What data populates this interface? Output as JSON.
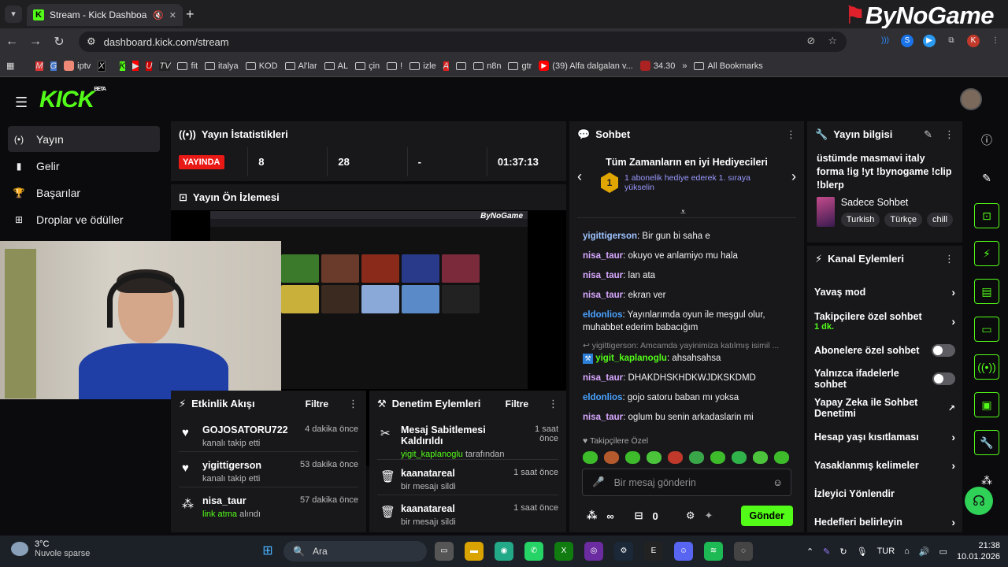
{
  "browser": {
    "tab_title": "Stream - Kick Dashboard",
    "url": "dashboard.kick.com/stream",
    "overlay_brand": "ByNoGame",
    "bookmarks": [
      "iptv",
      "fit",
      "italya",
      "KOD",
      "Al'lar",
      "AL",
      "çin",
      "!",
      "izle",
      "n8n",
      "gtr",
      "(39) Alfa dalgalan v...",
      "34.30"
    ],
    "all_bookmarks": "All Bookmarks",
    "profile_letter": "K"
  },
  "app": {
    "logo": "KICK",
    "logo_badge": "BETA",
    "nav": [
      {
        "label": "Yayın"
      },
      {
        "label": "Gelir"
      },
      {
        "label": "Başarılar"
      },
      {
        "label": "Droplar ve ödüller"
      }
    ]
  },
  "stats": {
    "title": "Yayın İstatistikleri",
    "live_label": "YAYINDA",
    "viewers": "8",
    "followers": "28",
    "dash": "-",
    "uptime": "01:37:13"
  },
  "preview": {
    "title": "Yayın Ön İzlemesi"
  },
  "activity": {
    "title": "Etkinlik Akışı",
    "filter": "Filtre",
    "items": [
      {
        "name": "GOJOSATORU722",
        "action": "kanalı takip etti",
        "time": "4 dakika önce"
      },
      {
        "name": "yigittigerson",
        "action": "kanalı takip etti",
        "time": "53 dakika önce"
      },
      {
        "name": "nisa_taur",
        "action_highlight": "link atma",
        "action": "alındı",
        "time": "57 dakika önce"
      }
    ]
  },
  "moderation": {
    "title": "Denetim Eylemleri",
    "filter": "Filtre",
    "items": [
      {
        "name": "Mesaj Sabitlemesi Kaldırıldı",
        "user": "yigit_kaplanoglu",
        "suffix": "tarafından",
        "time": "1 saat önce"
      },
      {
        "name": "kaanatareal",
        "action": "bir mesajı sildi",
        "time": "1 saat önce"
      },
      {
        "name": "kaanatareal",
        "action": "bir mesajı sildi",
        "time": "1 saat önce"
      }
    ]
  },
  "chat": {
    "title": "Sohbet",
    "gifters_title": "Tüm Zamanların en iyi Hediyecileri",
    "gift_rank": "1",
    "gift_text": "1 abonelik hediye ederek 1. sıraya yükselin",
    "messages": [
      {
        "user": "yigittigerson",
        "color": "#9ec3ff",
        "text": "Bir gun bi saha e"
      },
      {
        "user": "nisa_taur",
        "color": "#d8a8ff",
        "text": "okuyo ve anlamiyo mu hala"
      },
      {
        "user": "nisa_taur",
        "color": "#d8a8ff",
        "text": "lan ata"
      },
      {
        "user": "nisa_taur",
        "color": "#d8a8ff",
        "text": "ekran ver"
      },
      {
        "user": "eldonlios",
        "color": "#4aa3ff",
        "text": "Yayınlarımda oyun ile meşgul olur, muhabbet ederim babacığım"
      },
      {
        "reply": "yigittigerson: Amcamda yayinimiza katılmış isimil ...",
        "user": "yigit_kaplanoglu",
        "color": "#53fc18",
        "text": "ahsahsahsa"
      },
      {
        "user": "nisa_taur",
        "color": "#d8a8ff",
        "text": "DHAKDHSKHDKWJDKSKDMD"
      },
      {
        "user": "eldonlios",
        "color": "#4aa3ff",
        "text": "gojo satoru baban mı yoksa"
      },
      {
        "user": "nisa_taur",
        "color": "#d8a8ff",
        "text": "oglum bu senin arkadaslarin mi"
      }
    ],
    "follower_only": "Takipçilere Özel",
    "placeholder": "Bir mesaj gönderin",
    "points": "∞",
    "gift_count": "0",
    "send": "Gönder"
  },
  "stream_info": {
    "title": "Yayın bilgisi",
    "stream_title": "üstümde masmavi italy forma !ig !yt !bynogame !clip !blerp",
    "category": "Sadece Sohbet",
    "tags": [
      "Turkish",
      "Türkçe",
      "chill"
    ]
  },
  "channel_actions": {
    "title": "Kanal Eylemleri",
    "items": [
      {
        "label": "Yavaş mod",
        "type": "arrow"
      },
      {
        "label": "Takipçilere özel sohbet",
        "sub": "1 dk.",
        "type": "arrow"
      },
      {
        "label": "Abonelere özel sohbet",
        "type": "toggle"
      },
      {
        "label": "Yalnızca ifadelerle sohbet",
        "type": "toggle"
      },
      {
        "label": "Yapay Zeka ile Sohbet Denetimi",
        "type": "external"
      },
      {
        "label": "Hesap yaşı kısıtlaması",
        "type": "arrow"
      },
      {
        "label": "Yasaklanmış kelimeler",
        "type": "arrow"
      },
      {
        "label": "İzleyici Yönlendir",
        "type": "none"
      },
      {
        "label": "Hedefleri belirleyin",
        "type": "arrow"
      }
    ]
  },
  "taskbar": {
    "temp": "3°C",
    "weather": "Nuvole sparse",
    "search": "Ara",
    "lang": "TUR",
    "time": "21:38",
    "date": "10.01.2026"
  }
}
